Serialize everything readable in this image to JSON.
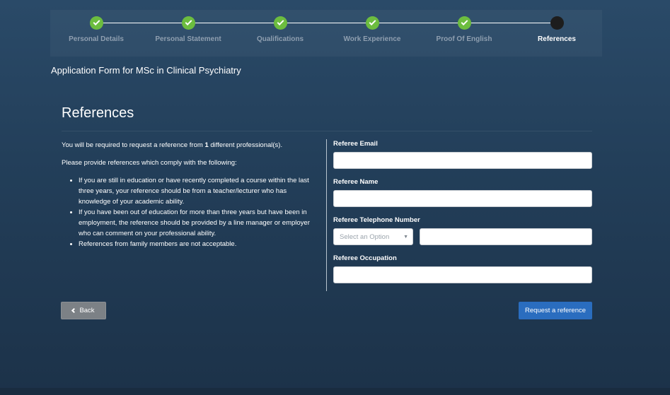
{
  "stepper": {
    "steps": [
      {
        "label": "Personal Details",
        "status": "complete"
      },
      {
        "label": "Personal Statement",
        "status": "complete"
      },
      {
        "label": "Qualifications",
        "status": "complete"
      },
      {
        "label": "Work Experience",
        "status": "complete"
      },
      {
        "label": "Proof Of English",
        "status": "complete"
      },
      {
        "label": "References",
        "status": "current"
      }
    ]
  },
  "app_title": "Application Form for MSc in Clinical Psychiatry",
  "section_title": "References",
  "info": {
    "intro_prefix": "You will be required to request a reference from ",
    "intro_count": "1",
    "intro_suffix": " different professional(s).",
    "comply": "Please provide references which comply with the following:",
    "bullets": [
      "If you are still in education or have recently completed a course within the last three years, your reference should be from a teacher/lecturer who has knowledge of your academic ability.",
      "If you have been out of education for more than three years but have been in employment, the reference should be provided by a line manager or employer who can comment on your professional ability.",
      "References from family members are not acceptable."
    ]
  },
  "form": {
    "email_label": "Referee Email",
    "email_value": "",
    "name_label": "Referee Name",
    "name_value": "",
    "phone_label": "Referee Telephone Number",
    "phone_select_placeholder": "Select an Option",
    "phone_value": "",
    "occupation_label": "Referee Occupation",
    "occupation_value": ""
  },
  "buttons": {
    "back_label": "Back",
    "request_label": "Request a reference"
  },
  "colors": {
    "complete": "#6cbd3f",
    "current": "#1d1d1d",
    "primary_button": "#2a6dbf",
    "back_button": "#7c8186"
  },
  "icons": {
    "check": "check-icon",
    "back": "chevron-left-icon",
    "select": "caret-down-icon"
  }
}
